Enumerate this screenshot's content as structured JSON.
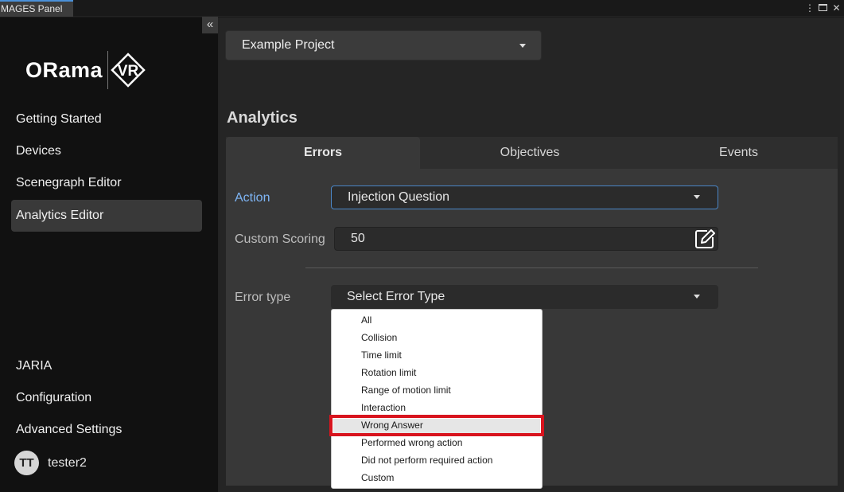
{
  "window": {
    "tab_title": "MAGES Panel",
    "menu_icon": "kebab-menu-icon",
    "maximize_icon": "maximize-icon",
    "close_icon": "close-icon"
  },
  "sidebar": {
    "collapse_icon": "double-chevron-left-icon",
    "logo_text": "ORama",
    "logo_badge": "VR",
    "nav_items": [
      {
        "label": "Getting Started"
      },
      {
        "label": "Devices"
      },
      {
        "label": "Scenegraph Editor"
      },
      {
        "label": "Analytics Editor",
        "active": true
      }
    ],
    "bottom_items": [
      {
        "label": "JARIA"
      },
      {
        "label": "Configuration"
      },
      {
        "label": "Advanced Settings"
      }
    ],
    "user": {
      "initials": "TT",
      "name": "tester2"
    }
  },
  "main": {
    "project_select": "Example Project",
    "section_title": "Analytics",
    "tabs": [
      {
        "label": "Errors",
        "active": true
      },
      {
        "label": "Objectives"
      },
      {
        "label": "Events"
      }
    ],
    "form": {
      "action_label": "Action",
      "action_value": "Injection Question",
      "custom_scoring_label": "Custom Scoring",
      "custom_scoring_value": "50",
      "edit_icon": "edit-pencil-icon",
      "error_type_label": "Error type",
      "error_type_value": "Select Error Type"
    },
    "error_type_options": [
      "All",
      "Collision",
      "Time limit",
      "Rotation limit",
      "Range of motion limit",
      "Interaction",
      "Wrong Answer",
      "Performed wrong action",
      "Did not perform required action",
      "Custom"
    ],
    "highlighted_option": "Wrong Answer",
    "highlight_color": "#d8141e",
    "accent_color": "#7eb5f5"
  }
}
